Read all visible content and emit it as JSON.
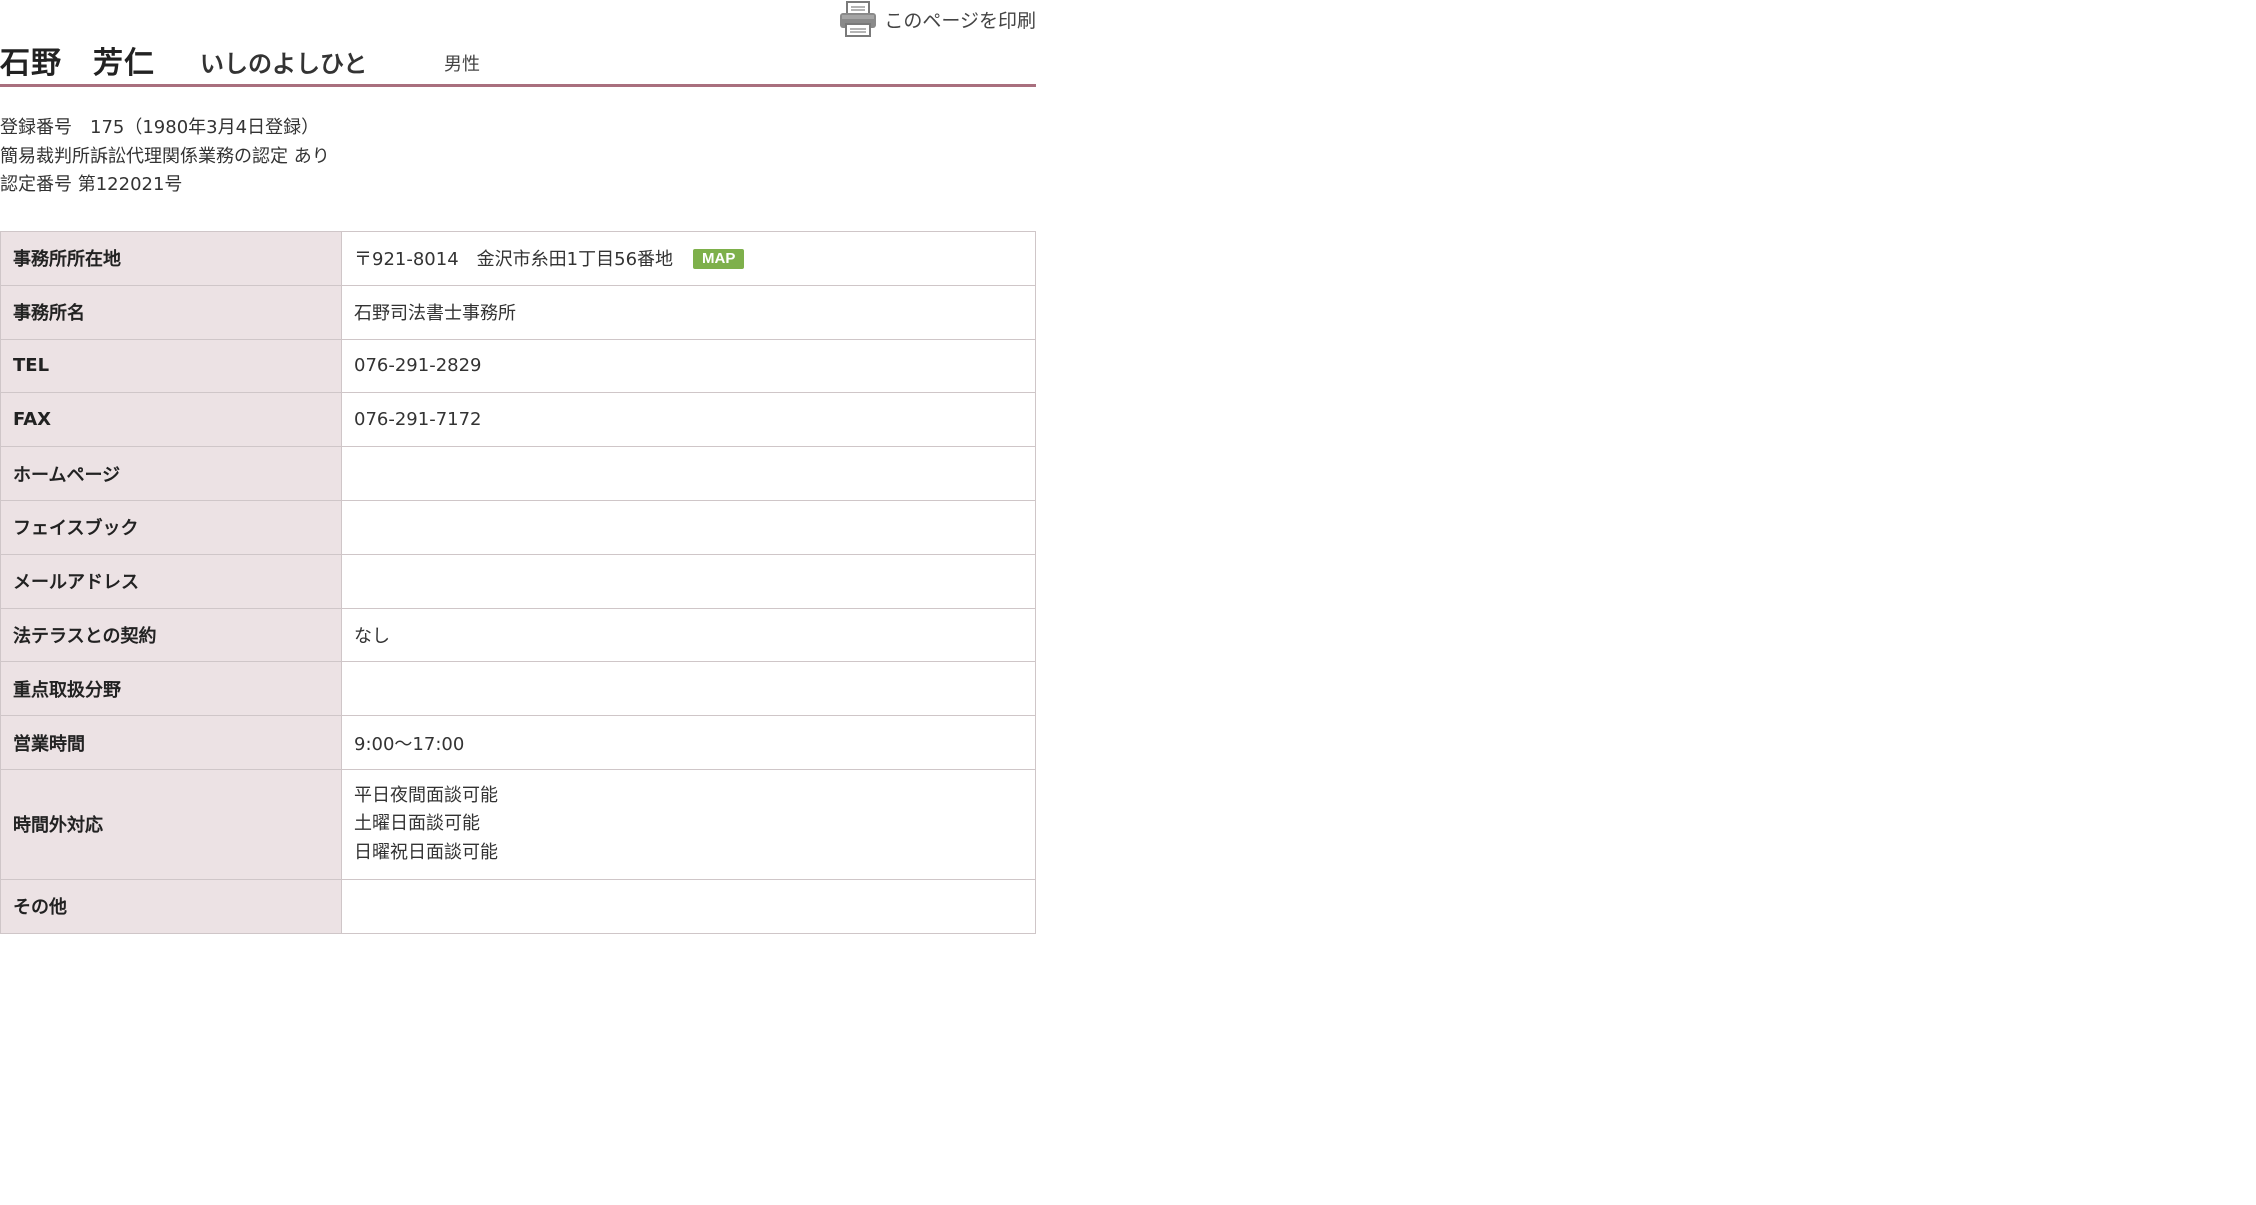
{
  "print": {
    "label": "このページを印刷",
    "icon": "printer-icon"
  },
  "profile": {
    "name": "石野　芳仁",
    "kana": "いしのよしひと",
    "gender": "男性"
  },
  "registration": {
    "number_line": "登録番号　175（1980年3月4日登録）",
    "summary_court_line": "簡易裁判所訴訟代理関係業務の認定 あり",
    "certification_line": "認定番号 第122021号"
  },
  "details": {
    "address": {
      "label": "事務所所在地",
      "value": "〒921-8014　金沢市糸田1丁目56番地",
      "map_label": "MAP"
    },
    "office_name": {
      "label": "事務所名",
      "value": "石野司法書士事務所"
    },
    "tel": {
      "label": "TEL",
      "value": "076-291-2829"
    },
    "fax": {
      "label": "FAX",
      "value": "076-291-7172"
    },
    "homepage": {
      "label": "ホームページ",
      "value": ""
    },
    "facebook": {
      "label": "フェイスブック",
      "value": ""
    },
    "email": {
      "label": "メールアドレス",
      "value": ""
    },
    "houterasu": {
      "label": "法テラスとの契約",
      "value": "なし"
    },
    "focus_areas": {
      "label": "重点取扱分野",
      "value": ""
    },
    "business_hours": {
      "label": "営業時間",
      "value": "9:00～17:00"
    },
    "off_hours": {
      "label": "時間外対応",
      "lines": [
        "平日夜間面談可能",
        "土曜日面談可能",
        "日曜祝日面談可能"
      ]
    },
    "other": {
      "label": "その他",
      "value": ""
    }
  },
  "colors": {
    "accent_rule": "#a96f7e",
    "label_bg": "#ece2e4",
    "map_button": "#7eb04b"
  }
}
